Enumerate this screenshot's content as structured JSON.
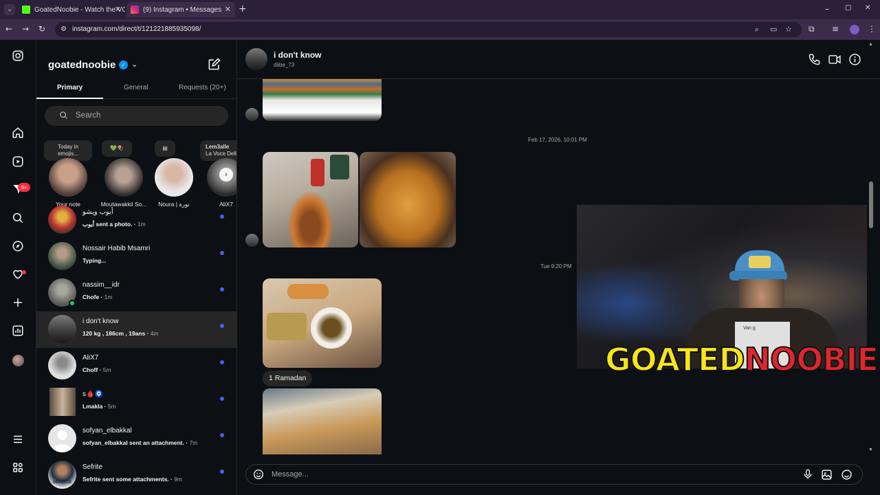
{
  "browser": {
    "tabs": [
      {
        "title": "GoatedNoobie - Watch the VO",
        "favicon_color": "#53fc18",
        "active": false
      },
      {
        "title": "(9) Instagram • Messages",
        "favicon_color": "#e1306c",
        "active": true
      }
    ],
    "new_tab": "+",
    "url": "instagram.com/direct/t/121221885935098/",
    "window_controls": [
      "–",
      "▢",
      "✕"
    ]
  },
  "rail": {
    "notification_badge": "9+",
    "icons": [
      "instagram-logo-icon",
      "home-icon",
      "reels-icon",
      "messages-icon",
      "search-icon",
      "explore-icon",
      "heart-icon",
      "create-icon",
      "dashboard-icon",
      "profile-avatar",
      "menu-icon",
      "threads-icon"
    ]
  },
  "inbox": {
    "username": "goatednoobie",
    "verified": true,
    "tabs": [
      "Primary",
      "General",
      "Requests (20+)"
    ],
    "search_placeholder": "Search",
    "notes": [
      {
        "text_line1": "Today in",
        "text_line2": "emojis..."
      },
      {
        "text_line1": "💚🪁"
      },
      {
        "text_line1": "▤"
      },
      {
        "text_line1": "Lem3alle",
        "text_line2": "La Voce Della"
      }
    ],
    "stories": [
      {
        "label": "Your note"
      },
      {
        "label": "Moutawakkil So..."
      },
      {
        "label": "Noura | نورة"
      },
      {
        "label": "AliX7"
      }
    ],
    "conversations": [
      {
        "name": "أيوب ويشو",
        "preview": "أيوب sent a photo.",
        "time": "1m",
        "unread": true
      },
      {
        "name": "Nossair Habib Msamri",
        "preview": "Typing...",
        "time": "",
        "unread": true
      },
      {
        "name": "nassim__idr",
        "preview": "Chofe",
        "time": "1m",
        "unread": true
      },
      {
        "name": "i don't know",
        "preview": "120 kg , 186cm , 19ans",
        "time": "4m",
        "unread": true
      },
      {
        "name": "AliX7",
        "preview": "Choff",
        "time": "5m",
        "unread": true
      },
      {
        "name": "s🩸🧿",
        "preview": "Lmakla",
        "time": "5m",
        "unread": true
      },
      {
        "name": "sofyan_elbakkal",
        "preview": "sofyan_elbakkal sent an attachment.",
        "time": "7m",
        "unread": true
      },
      {
        "name": "Sefrite",
        "preview": "Sefrite sent some attachments.",
        "time": "9m",
        "unread": true
      }
    ],
    "sefrite_avatar_text": "SEFRITE"
  },
  "chat": {
    "title": "i don't know",
    "subtitle": "diibe_73",
    "timestamp_1": "Feb 17, 2026, 10:01 PM",
    "timestamp_2": "Tue 9:20 PM",
    "caption": "1 Ramadan",
    "message_placeholder": "Message...",
    "overlay_text_1": "GOATED",
    "overlay_text_2": "NOOBIE",
    "cap_label": "Van g"
  },
  "colors": {
    "accent_blue": "#4a5df9",
    "verified_blue": "#0095f6",
    "badge_red": "#ff3040",
    "overlay_yellow": "#f7e51a",
    "overlay_red": "#e0252e"
  }
}
